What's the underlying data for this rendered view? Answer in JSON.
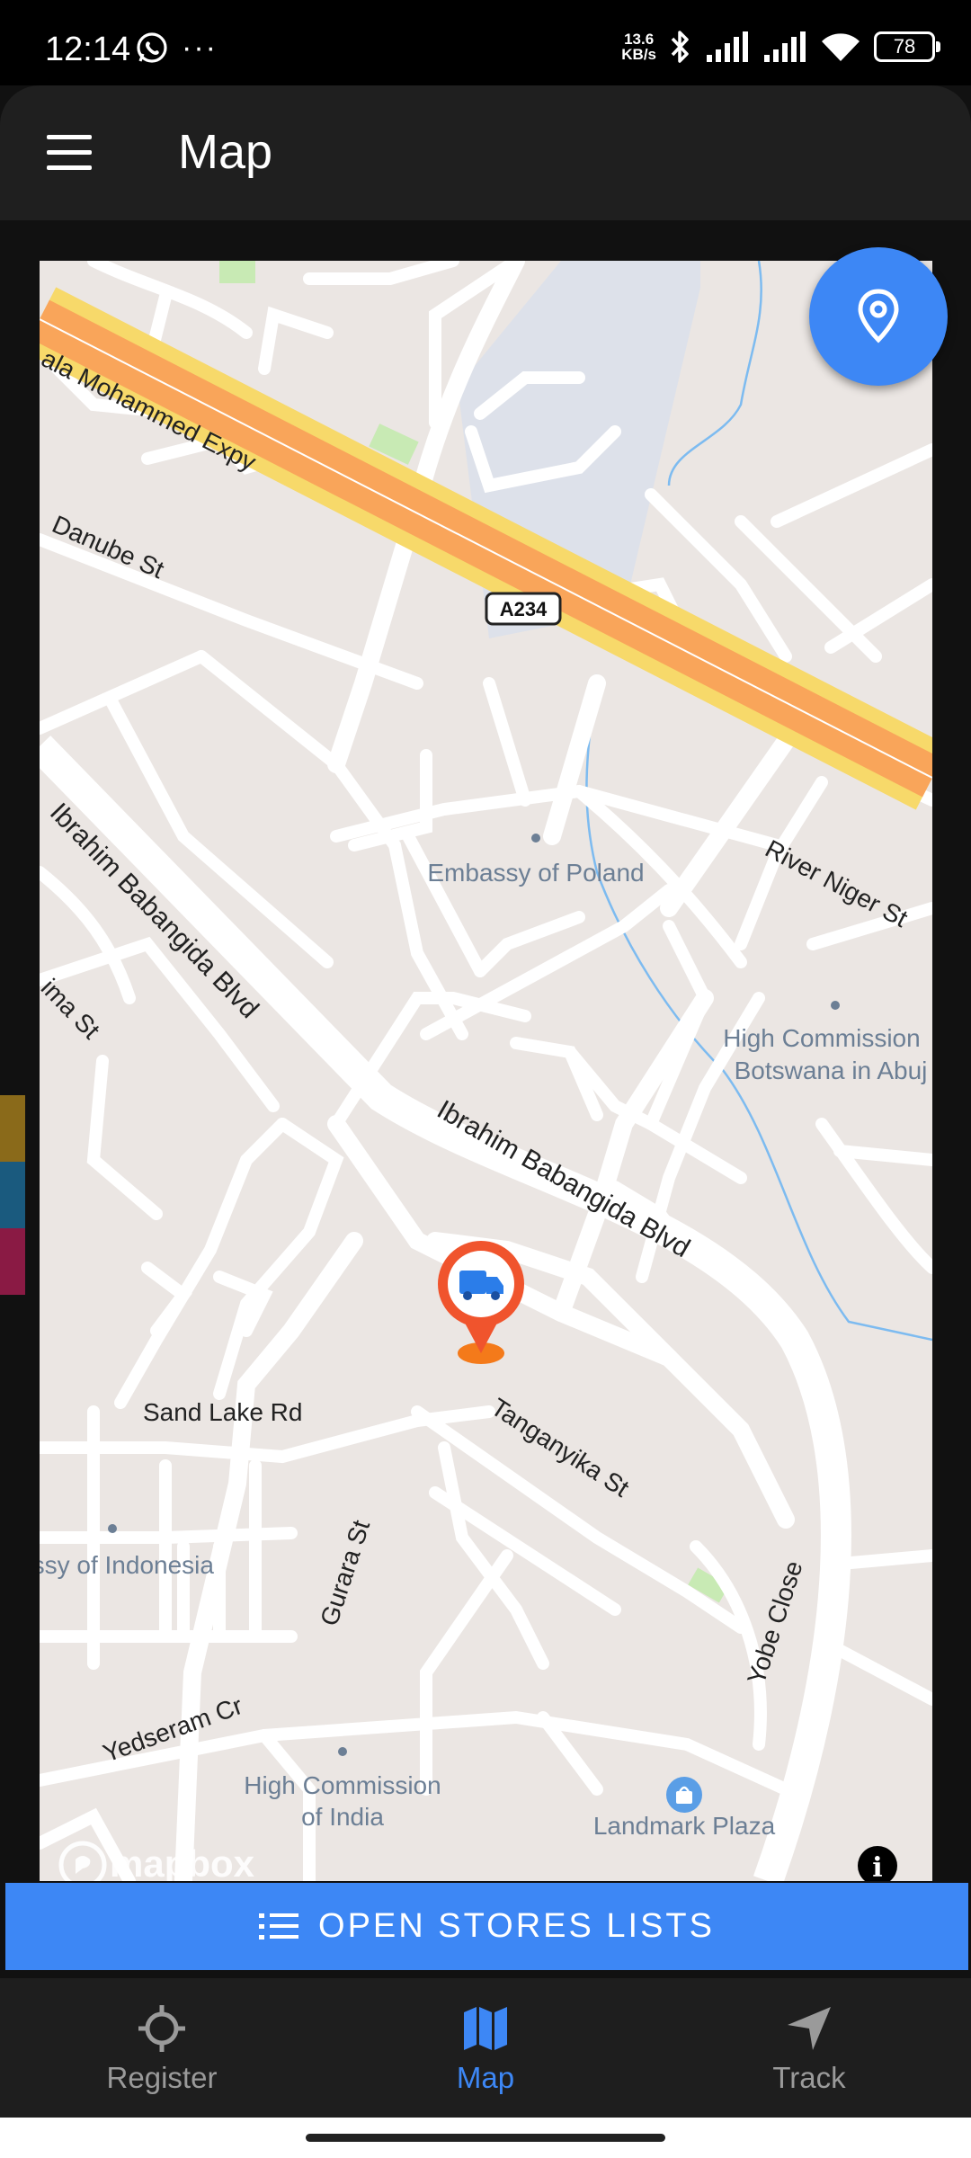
{
  "status_bar": {
    "time": "12:14",
    "more": "···",
    "net_speed_value": "13.6",
    "net_speed_unit": "KB/s",
    "battery": "78"
  },
  "app_bar": {
    "title": "Map"
  },
  "map": {
    "labels": {
      "expressway": "ala Mohammed Expy",
      "route_shield": "A234",
      "danube": "Danube St",
      "embassy_poland": "Embassy of Poland",
      "river_niger": "River Niger St",
      "ibb_blvd_1": "Ibrahim Babangida Blvd",
      "ibb_blvd_2": "Ibrahim Babangida Blvd",
      "ima_st": "ima St",
      "hc_botswana_1": "High Commission",
      "hc_botswana_2": "Botswana in Abuj",
      "sand_lake": "Sand Lake Rd",
      "tanganyika": "Tanganyika St",
      "embassy_indonesia": "assy of Indonesia",
      "gurara": "Gurara St",
      "yobe": "Yobe Close",
      "yedseram": "Yedseram Cr",
      "hc_india_1": "High Commission",
      "hc_india_2": "of India",
      "landmark": "Landmark Plaza",
      "mapbox": "mapbox",
      "info": "i"
    },
    "colors": {
      "land": "#ebe6e3",
      "road": "#ffffff",
      "motorway": "#f9a55a",
      "motorway_edge": "#f7d96a",
      "water": "#7dbbf0",
      "park": "#c8eab4",
      "poi_text": "#6c7f95",
      "marker": "#f0542d"
    }
  },
  "side_tabs": {
    "colors": [
      "#8a6a1a",
      "#1a5a7e",
      "#8a1a44"
    ]
  },
  "open_stores": {
    "label": "OPEN STORES LISTS"
  },
  "bottom_nav": {
    "items": [
      {
        "label": "Register",
        "icon": "crosshair-icon",
        "active": false
      },
      {
        "label": "Map",
        "icon": "map-icon",
        "active": true
      },
      {
        "label": "Track",
        "icon": "navigation-arrow-icon",
        "active": false
      }
    ]
  }
}
